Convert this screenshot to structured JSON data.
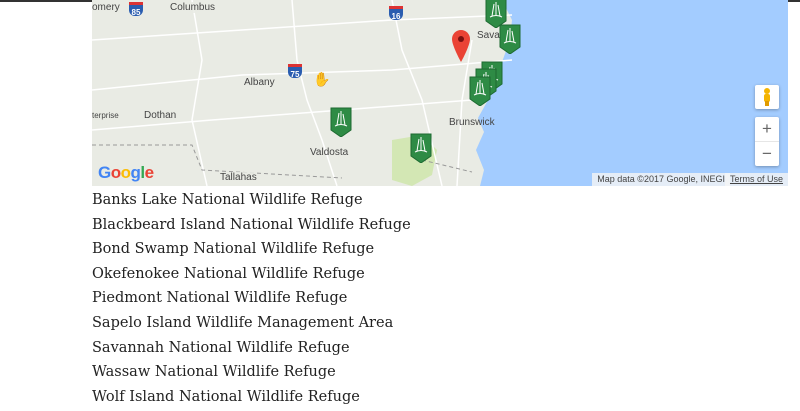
{
  "map": {
    "labels": {
      "montgomery": "omery",
      "columbus": "Columbus",
      "albany": "Albany",
      "dothan": "Dothan",
      "enterprise": "terprise",
      "valdosta": "Valdosta",
      "brunswick": "Brunswick",
      "savannah": "Sava",
      "tallahassee": "Tallahas"
    },
    "highways": {
      "i85": "85",
      "i75": "75",
      "i16": "16"
    },
    "logo": "Google",
    "attribution": "Map data ©2017 Google, INEGI",
    "terms": "Terms of Use",
    "zoom_in": "+",
    "zoom_out": "−",
    "colors": {
      "land": "#e9ebe4",
      "water": "#a3ccff",
      "marker": "#2e8b45",
      "pin": "#ea4335"
    }
  },
  "refuges": [
    "Banks Lake National Wildlife Refuge",
    "Blackbeard Island National Wildlife Refuge",
    "Bond Swamp National Wildlife Refuge",
    "Okefenokee National Wildlife Refuge",
    "Piedmont National Wildlife Refuge",
    "Sapelo Island Wildlife Management Area",
    "Savannah National Wildlife Refuge",
    "Wassaw National Wildlife Refuge",
    "Wolf Island National Wildlife Refuge"
  ]
}
